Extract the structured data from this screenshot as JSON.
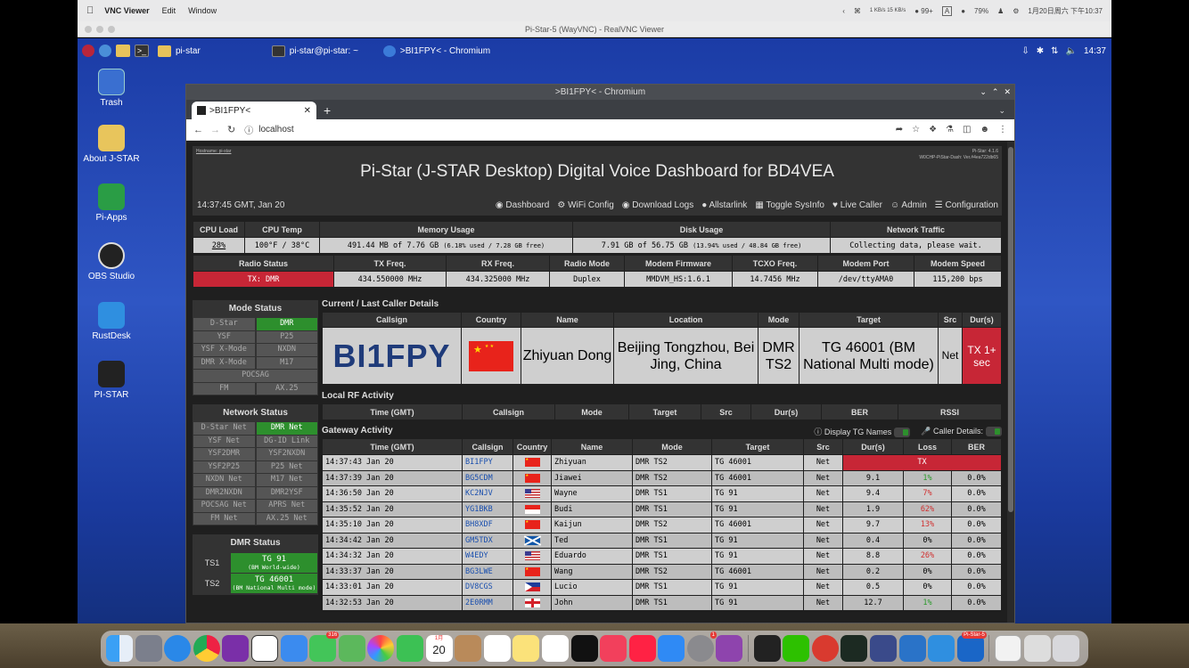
{
  "mac_menubar": {
    "app": "VNC Viewer",
    "menus": [
      "Edit",
      "Window"
    ],
    "battery": "79%",
    "datetime": "1月20日周六 下午10:37",
    "wechat_badge": "99+",
    "net_speed": "1 KB/s 15 KB/s",
    "input_method": "A"
  },
  "vnc_window_title": "Pi-Star-5 (WayVNC) - RealVNC Viewer",
  "pi_taskbar": {
    "tasks": [
      "pi-star",
      "pi-star@pi-star: ~",
      ">BI1FPY< - Chromium"
    ],
    "clock": "14:37"
  },
  "desktop_icons": [
    "Trash",
    "About J-STAR",
    "Pi-Apps",
    "OBS Studio",
    "RustDesk",
    "PI-STAR"
  ],
  "chromium": {
    "window_title": ">BI1FPY< - Chromium",
    "tab_title": ">BI1FPY<",
    "url": "localhost"
  },
  "dashboard": {
    "hostname": "Hostname: pi-star",
    "version_line1": "Pi-Star: 4.1.6",
    "version_line2": "W0CHP-PiStar-Dash: Ver.#4ea722db65",
    "title": "Pi-Star (J-STAR Desktop) Digital Voice Dashboard for BD4VEA",
    "time": "14:37:45 GMT, Jan 20",
    "nav": [
      "Dashboard",
      "WiFi Config",
      "Download Logs",
      "Allstarlink",
      "Toggle SysInfo",
      "Live Caller",
      "Admin",
      "Configuration"
    ]
  },
  "sysinfo": {
    "headers1": [
      "CPU Load",
      "CPU Temp",
      "Memory Usage",
      "Disk Usage",
      "Network Traffic"
    ],
    "cpu_load": "28%",
    "cpu_temp": "100°F / 38°C",
    "memory_main": "491.44 MB of 7.76 GB",
    "memory_detail": "(6.18% used / 7.28 GB free)",
    "disk_main": "7.91 GB of 56.75 GB",
    "disk_detail": "(13.94% used / 48.84 GB free)",
    "network": "Collecting data, please wait.",
    "headers2": [
      "Radio Status",
      "TX Freq.",
      "RX Freq.",
      "Radio Mode",
      "Modem Firmware",
      "TCXO Freq.",
      "Modem Port",
      "Modem Speed"
    ],
    "row2": [
      "TX: DMR",
      "434.550000 MHz",
      "434.325000 MHz",
      "Duplex",
      "MMDVM_HS:1.6.1",
      "14.7456 MHz",
      "/dev/ttyAMA0",
      "115,200 bps"
    ]
  },
  "mode_status": {
    "title": "Mode Status",
    "items": [
      "D-Star",
      "DMR",
      "YSF",
      "P25",
      "YSF X-Mode",
      "NXDN",
      "DMR X-Mode",
      "M17",
      "POCSAG",
      "FM",
      "AX.25"
    ]
  },
  "network_status": {
    "title": "Network Status",
    "items": [
      "D-Star Net",
      "DMR Net",
      "YSF Net",
      "DG-ID Link",
      "YSF2DMR",
      "YSF2NXDN",
      "YSF2P25",
      "P25 Net",
      "NXDN Net",
      "M17 Net",
      "DMR2NXDN",
      "DMR2YSF",
      "POCSAG Net",
      "APRS Net",
      "FM Net",
      "AX.25 Net"
    ]
  },
  "dmr_status": {
    "title": "DMR Status",
    "ts1_label": "TS1",
    "ts1_tg": "TG 91",
    "ts1_sub": "(BM World-wide)",
    "ts2_label": "TS2",
    "ts2_tg": "TG 46001",
    "ts2_sub": "(BM National Multi mode)"
  },
  "last_caller": {
    "section_title": "Current / Last Caller Details",
    "headers": [
      "Callsign",
      "Country",
      "Name",
      "Location",
      "Mode",
      "Target",
      "Src",
      "Dur(s)"
    ],
    "callsign": "BI1FPY",
    "name": "Zhiyuan Dong",
    "location": "Beijing Tongzhou, Bei Jing, China",
    "mode": "DMR TS2",
    "target": "TG 46001 (BM National Multi mode)",
    "src": "Net",
    "dur": "TX 1+ sec"
  },
  "local_rf": {
    "section_title": "Local RF Activity",
    "headers": [
      "Time (GMT)",
      "Callsign",
      "Mode",
      "Target",
      "Src",
      "Dur(s)",
      "BER",
      "RSSI"
    ]
  },
  "gateway": {
    "section_title": "Gateway Activity",
    "opt_tg_names": "Display TG Names",
    "opt_caller_details": "Caller Details:",
    "headers": [
      "Time (GMT)",
      "Callsign",
      "Country",
      "Name",
      "Mode",
      "Target",
      "Src",
      "Dur(s)",
      "Loss",
      "BER"
    ],
    "rows": [
      {
        "time": "14:37:43 Jan 20",
        "call": "BI1FPY",
        "flag": "cn",
        "name": "Zhiyuan",
        "mode": "DMR TS2",
        "target": "TG 46001",
        "src": "Net",
        "dur": "",
        "loss": "TX",
        "ber": "",
        "tx": true
      },
      {
        "time": "14:37:39 Jan 20",
        "call": "BG5CDM",
        "flag": "cn",
        "name": "Jiawei",
        "mode": "DMR TS2",
        "target": "TG 46001",
        "src": "Net",
        "dur": "9.1",
        "loss": "1%",
        "ber": "0.0%",
        "loss_class": "good"
      },
      {
        "time": "14:36:50 Jan 20",
        "call": "KC2NJV",
        "flag": "us",
        "name": "Wayne",
        "mode": "DMR TS1",
        "target": "TG 91",
        "src": "Net",
        "dur": "9.4",
        "loss": "7%",
        "ber": "0.0%",
        "loss_class": "bad"
      },
      {
        "time": "14:35:52 Jan 20",
        "call": "YG1BKB",
        "flag": "id",
        "name": "Budi",
        "mode": "DMR TS1",
        "target": "TG 91",
        "src": "Net",
        "dur": "1.9",
        "loss": "62%",
        "ber": "0.0%",
        "loss_class": "bad"
      },
      {
        "time": "14:35:10 Jan 20",
        "call": "BH8XDF",
        "flag": "cn",
        "name": "Kaijun",
        "mode": "DMR TS2",
        "target": "TG 46001",
        "src": "Net",
        "dur": "9.7",
        "loss": "13%",
        "ber": "0.0%",
        "loss_class": "bad"
      },
      {
        "time": "14:34:42 Jan 20",
        "call": "GM5TDX",
        "flag": "sc",
        "name": "Ted",
        "mode": "DMR TS1",
        "target": "TG 91",
        "src": "Net",
        "dur": "0.4",
        "loss": "0%",
        "ber": "0.0%",
        "loss_class": ""
      },
      {
        "time": "14:34:32 Jan 20",
        "call": "W4EDY",
        "flag": "us",
        "name": "Eduardo",
        "mode": "DMR TS1",
        "target": "TG 91",
        "src": "Net",
        "dur": "8.8",
        "loss": "26%",
        "ber": "0.0%",
        "loss_class": "bad"
      },
      {
        "time": "14:33:37 Jan 20",
        "call": "BG3LWE",
        "flag": "cn",
        "name": "Wang",
        "mode": "DMR TS2",
        "target": "TG 46001",
        "src": "Net",
        "dur": "0.2",
        "loss": "0%",
        "ber": "0.0%",
        "loss_class": ""
      },
      {
        "time": "14:33:01 Jan 20",
        "call": "DV8CGS",
        "flag": "ph",
        "name": "Lucio",
        "mode": "DMR TS1",
        "target": "TG 91",
        "src": "Net",
        "dur": "0.5",
        "loss": "0%",
        "ber": "0.0%",
        "loss_class": ""
      },
      {
        "time": "14:32:53 Jan 20",
        "call": "2E0RMM",
        "flag": "en",
        "name": "John",
        "mode": "DMR TS1",
        "target": "TG 91",
        "src": "Net",
        "dur": "12.7",
        "loss": "1%",
        "ber": "0.0%",
        "loss_class": "good"
      }
    ]
  },
  "dock": {
    "messages_badge": "316",
    "calendar_date": "20",
    "calendar_month": "1月",
    "settings_badge": "1",
    "pistar_label": "Pi-Star-5"
  },
  "colors": {
    "tx_red": "#c72636",
    "active_green": "#2d8f2d",
    "callsign_blue": "#1f3b7a"
  }
}
